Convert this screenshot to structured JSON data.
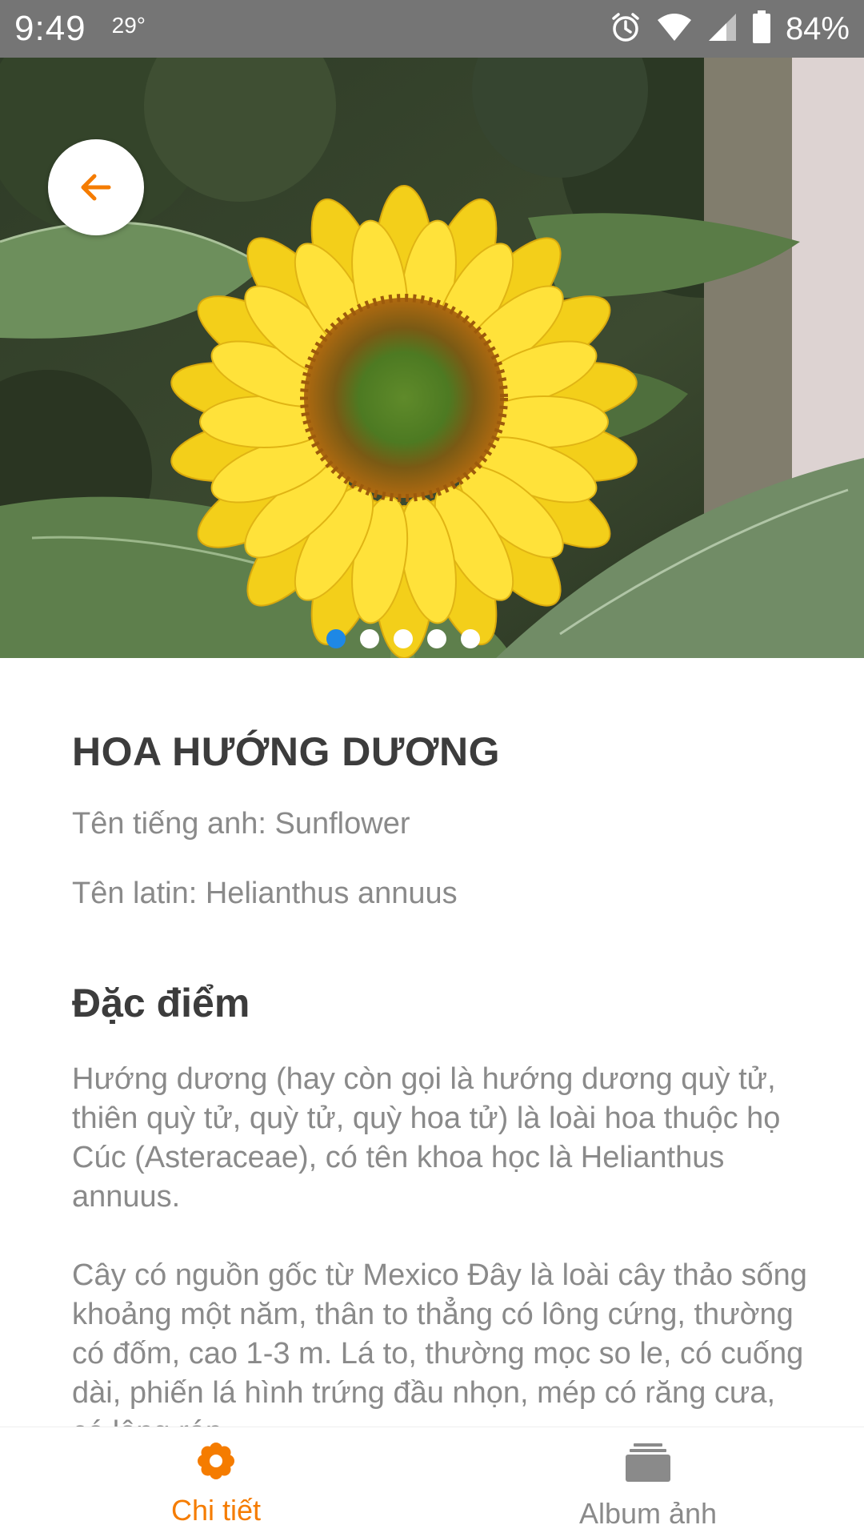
{
  "status_bar": {
    "time": "9:49",
    "temperature": "29°",
    "battery": "84%",
    "icons": [
      "alarm-icon",
      "wifi-icon",
      "signal-icon",
      "battery-icon"
    ]
  },
  "hero": {
    "carousel_count": 5,
    "active_index": 0,
    "icons": [
      "back-arrow-icon"
    ],
    "colors": {
      "back_arrow": "#f57c00",
      "active_dot": "#1e88e5",
      "dot": "#ffffff"
    }
  },
  "detail": {
    "title": "HOA HƯỚNG DƯƠNG",
    "english_name": "Tên tiếng anh: Sunflower",
    "latin_name": "Tên latin: Helianthus annuus",
    "section_heading": "Đặc điểm",
    "paragraphs": [
      "Hướng dương (hay còn gọi là hướng dương quỳ tử, thiên quỳ tử, quỳ tử, quỳ hoa tử) là loài hoa thuộc họ Cúc (Asteraceae), có tên khoa học là Helianthus annuus.",
      "Cây có nguồn gốc từ Mexico Đây là loài cây thảo sống khoảng một năm, thân to thẳng có lông cứng, thường có đốm, cao 1-3 m. Lá to, thường mọc so le, có cuống dài, phiến lá hình trứng đầu nhọn, mép có răng cưa, có lông ráp."
    ]
  },
  "bottom_nav": {
    "items": [
      {
        "label": "Chi tiết",
        "icon": "flower-icon",
        "active": true
      },
      {
        "label": "Album ảnh",
        "icon": "album-icon",
        "active": false
      }
    ],
    "colors": {
      "active": "#f57c00",
      "inactive": "#8a8a8a"
    }
  }
}
